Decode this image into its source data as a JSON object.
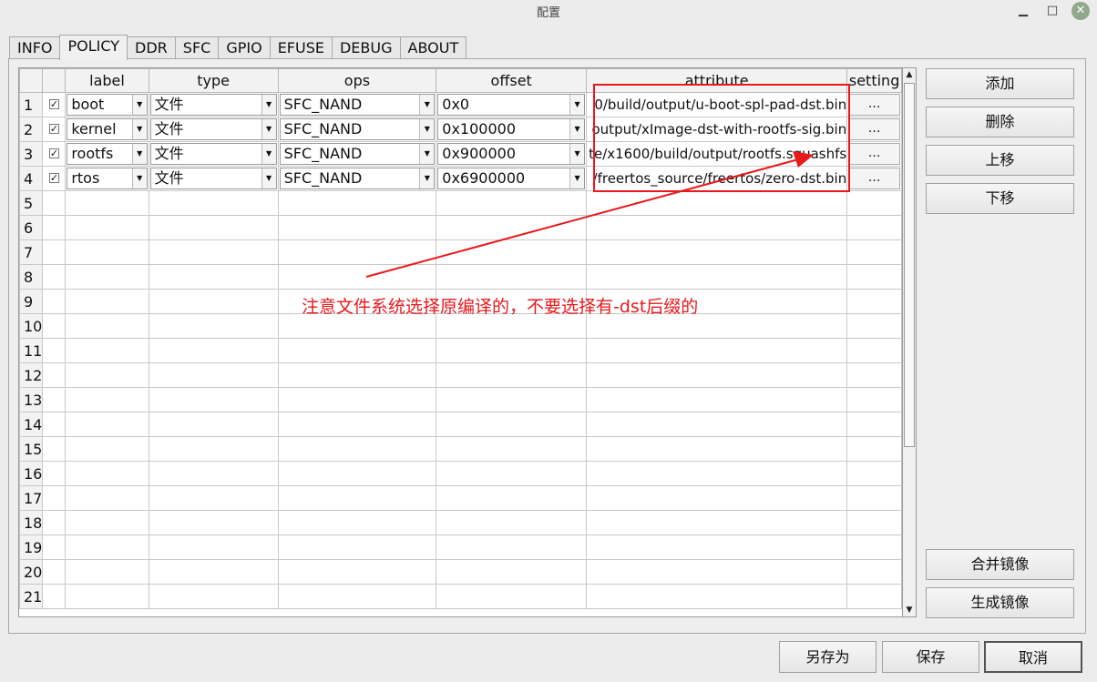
{
  "window": {
    "title": "配置",
    "min_glyph": "▁",
    "max_glyph": "□",
    "close_glyph": "✕"
  },
  "tabs": [
    "INFO",
    "POLICY",
    "DDR",
    "SFC",
    "GPIO",
    "EFUSE",
    "DEBUG",
    "ABOUT"
  ],
  "active_tab": "POLICY",
  "table": {
    "headers": {
      "label": "label",
      "type": "type",
      "ops": "ops",
      "offset": "offset",
      "attribute": "attribute",
      "setting": "setting"
    },
    "rows": [
      {
        "num": "1",
        "checked": true,
        "label": "boot",
        "type": "文件",
        "ops": "SFC_NAND",
        "offset": "0x0",
        "attribute": "0/build/output/u-boot-spl-pad-dst.bin",
        "setting": "..."
      },
      {
        "num": "2",
        "checked": true,
        "label": "kernel",
        "type": "文件",
        "ops": "SFC_NAND",
        "offset": "0x100000",
        "attribute": "output/xImage-dst-with-rootfs-sig.bin",
        "setting": "..."
      },
      {
        "num": "3",
        "checked": true,
        "label": "rootfs",
        "type": "文件",
        "ops": "SFC_NAND",
        "offset": "0x900000",
        "attribute": "te/x1600/build/output/rootfs.squashfs",
        "setting": "..."
      },
      {
        "num": "4",
        "checked": true,
        "label": "rtos",
        "type": "文件",
        "ops": "SFC_NAND",
        "offset": "0x6900000",
        "attribute": "/freertos_source/freertos/zero-dst.bin",
        "setting": "..."
      }
    ],
    "empty_row_numbers": [
      "5",
      "6",
      "7",
      "8",
      "9",
      "10",
      "11",
      "12",
      "13",
      "14",
      "15",
      "16",
      "17",
      "18",
      "19",
      "20",
      "21"
    ]
  },
  "side_buttons": {
    "add": "添加",
    "delete": "删除",
    "move_up": "上移",
    "move_down": "下移",
    "merge_image": "合并镜像",
    "generate_image": "生成镜像"
  },
  "bottom_buttons": {
    "save_as": "另存为",
    "save": "保存",
    "cancel": "取消"
  },
  "annotation": {
    "text": "注意文件系统选择原编译的，不要选择有-dst后缀的",
    "color": "#e8181b"
  },
  "colors": {
    "annotation_red": "#e8181b",
    "background": "#ececec"
  }
}
